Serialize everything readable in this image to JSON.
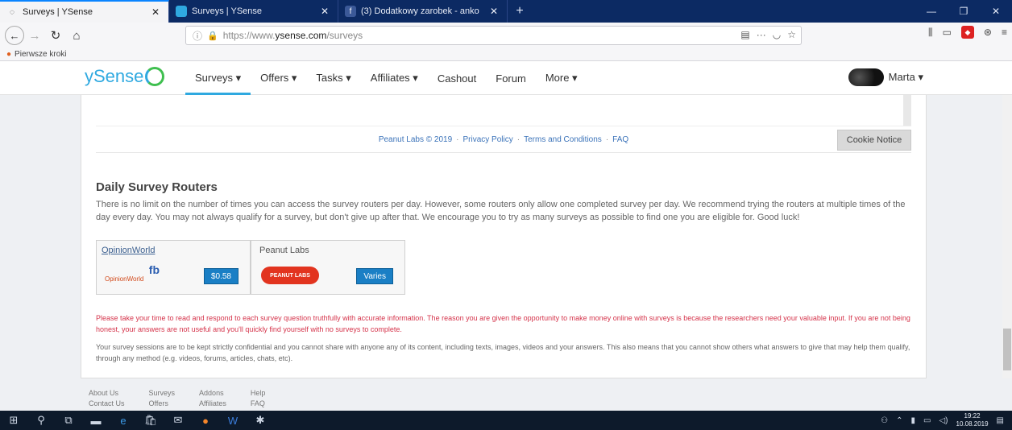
{
  "browser": {
    "tabs": [
      {
        "title": "Surveys | YSense",
        "active": true
      },
      {
        "title": "Surveys | YSense",
        "active": false
      },
      {
        "title": "(3) Dodatkowy zarobek - anko",
        "active": false
      }
    ],
    "new_tab": "+",
    "url_scheme": "https://www.",
    "url_host": "ysense.com",
    "url_path": "/surveys",
    "bookmark": "Pierwsze kroki"
  },
  "site": {
    "logo": "ySense",
    "nav": [
      {
        "label": "Surveys ▾",
        "active": true
      },
      {
        "label": "Offers ▾",
        "active": false
      },
      {
        "label": "Tasks ▾",
        "active": false
      },
      {
        "label": "Affiliates ▾",
        "active": false
      },
      {
        "label": "Cashout",
        "active": false
      },
      {
        "label": "Forum",
        "active": false
      },
      {
        "label": "More ▾",
        "active": false
      }
    ],
    "user_name": "Marta ▾"
  },
  "frame_footer": {
    "copyright": "Peanut Labs © 2019",
    "privacy": "Privacy Policy",
    "terms": "Terms and Conditions",
    "faq": "FAQ",
    "sep": "·",
    "cookie_button": "Cookie Notice"
  },
  "routers_section": {
    "title": "Daily Survey Routers",
    "text": "There is no limit on the number of times you can access the survey routers per day. However, some routers only allow one completed survey per day. We recommend trying the routers at multiple times of the day every day. You may not always qualify for a survey, but don't give up after that. We encourage you to try as many surveys as possible to find one you are eligible for. Good luck!",
    "routers": [
      {
        "name": "OpinionWorld",
        "logo_text": "OpinionWorld",
        "button": "$0.58"
      },
      {
        "name": "Peanut Labs",
        "logo_text": "PEANUT LABS",
        "button": "Varies"
      }
    ]
  },
  "warning": "Please take your time to read and respond to each survey question truthfully with accurate information. The reason you are given the opportunity to make money online with surveys is because the researchers need your valuable input. If you are not being honest, your answers are not useful and you'll quickly find yourself with no surveys to complete.",
  "note": "Your survey sessions are to be kept strictly confidential and you cannot share with anyone any of its content, including texts, images, videos and your answers. This also means that you cannot show others what answers to give that may help them qualify, through any method (e.g. videos, forums, articles, chats, etc).",
  "footer": {
    "col1": [
      "About Us",
      "Contact Us"
    ],
    "col2": [
      "Surveys",
      "Offers"
    ],
    "col3": [
      "Addons",
      "Affiliates"
    ],
    "col4": [
      "Help",
      "FAQ"
    ]
  },
  "taskbar": {
    "time": "19:22",
    "date": "10.08.2019"
  }
}
